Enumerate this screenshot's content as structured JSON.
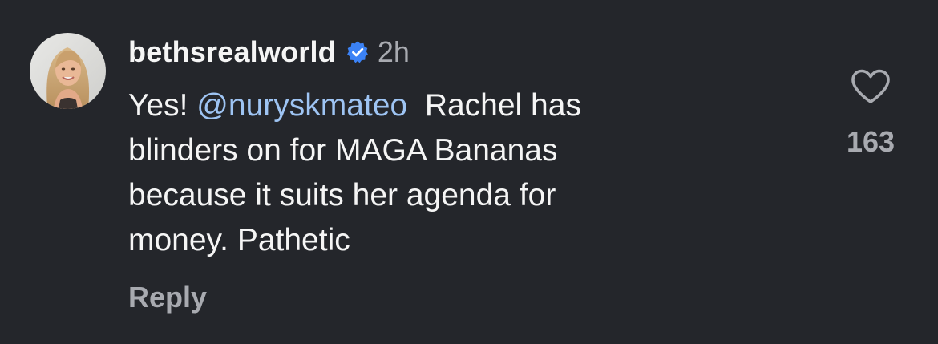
{
  "comment": {
    "username": "bethsrealworld",
    "verified_icon": "verified-badge-icon",
    "time": "2h",
    "text_lines": [
      {
        "before": "Yes! ",
        "mention": "@nuryskmateo",
        "after": "  Rachel has"
      },
      {
        "text": "blinders on for MAGA Bananas"
      },
      {
        "text": "because it suits her agenda for"
      },
      {
        "text": "money. Pathetic"
      }
    ],
    "reply_label": "Reply",
    "like_icon": "heart-outline-icon",
    "like_count": "163"
  },
  "colors": {
    "background": "#24262b",
    "text": "#f5f5f5",
    "secondary_text": "#a8aab0",
    "mention": "#9ec4f3",
    "verified": "#3b82f6"
  }
}
